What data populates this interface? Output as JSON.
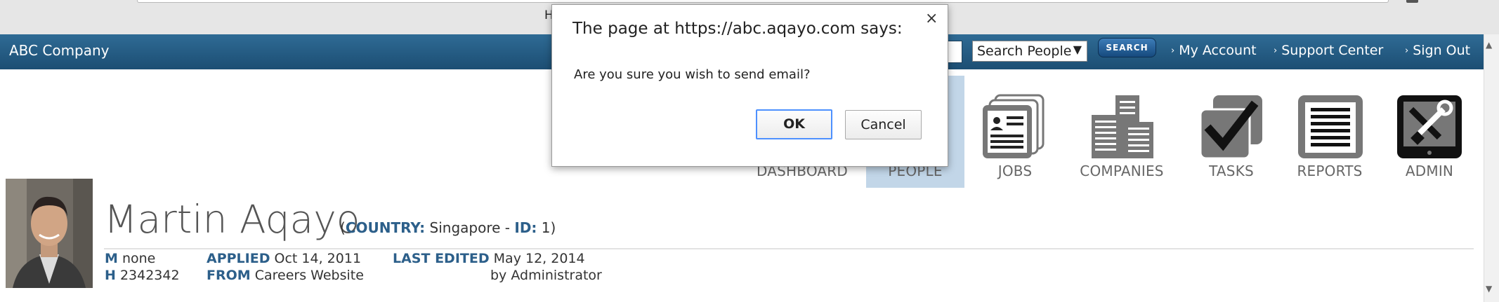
{
  "browser": {
    "tab_fragment": "H"
  },
  "navbar": {
    "brand": "ABC Company",
    "search_select": "Search People",
    "search_button": "SEARCH",
    "links": [
      "My Account",
      "Support Center",
      "Sign Out"
    ]
  },
  "modules": [
    {
      "label": "DASHBOARD",
      "icon": "dashboard-icon"
    },
    {
      "label": "PEOPLE",
      "icon": "people-icon",
      "active": true
    },
    {
      "label": "JOBS",
      "icon": "jobs-icon"
    },
    {
      "label": "COMPANIES",
      "icon": "companies-icon"
    },
    {
      "label": "TASKS",
      "icon": "tasks-icon"
    },
    {
      "label": "REPORTS",
      "icon": "reports-icon"
    },
    {
      "label": "ADMIN",
      "icon": "admin-icon"
    }
  ],
  "profile": {
    "name": "Martin Aqayo",
    "country_label": "COUNTRY:",
    "country": "Singapore",
    "separator": " - ",
    "id_label": "ID:",
    "id": "1",
    "m_label": "M",
    "m_value": "none",
    "h_label": "H",
    "h_value": "2342342",
    "applied_label": "APPLIED",
    "applied_value": "Oct 14, 2011",
    "from_label": "FROM",
    "from_value": "Careers Website",
    "last_edited_label": "LAST EDITED",
    "last_edited_value": "May 12, 2014",
    "edited_by": "by Administrator"
  },
  "dialog": {
    "title": "The page at https://abc.aqayo.com says:",
    "message": "Are you sure you wish to send email?",
    "ok": "OK",
    "cancel": "Cancel",
    "close_glyph": "×"
  },
  "colors": {
    "navbar": "#1c4e73",
    "label_blue": "#2c5f8a",
    "active_tile": "#c2d6e8",
    "focus_ring": "#4d90fe"
  }
}
